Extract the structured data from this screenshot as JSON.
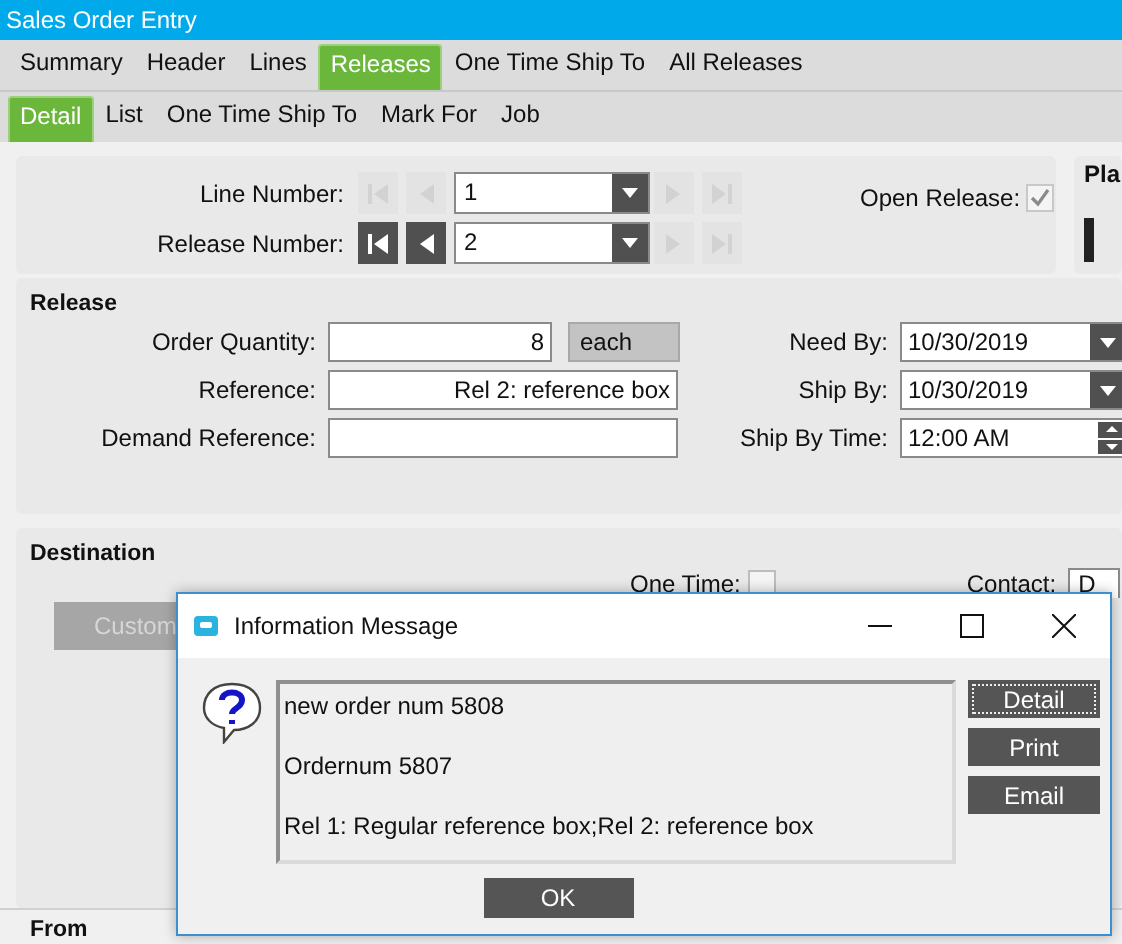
{
  "window": {
    "title": "Sales Order Entry"
  },
  "tabs": [
    {
      "label": "Summary",
      "selected": false
    },
    {
      "label": "Header",
      "selected": false
    },
    {
      "label": "Lines",
      "selected": false
    },
    {
      "label": "Releases",
      "selected": true
    },
    {
      "label": "One Time Ship To",
      "selected": false
    },
    {
      "label": "All Releases",
      "selected": false
    }
  ],
  "subtabs": [
    {
      "label": "Detail",
      "selected": true
    },
    {
      "label": "List",
      "selected": false
    },
    {
      "label": "One Time Ship To",
      "selected": false
    },
    {
      "label": "Mark For",
      "selected": false
    },
    {
      "label": "Job",
      "selected": false
    }
  ],
  "selectors": [
    {
      "label": "Line Number:",
      "value": "1",
      "nav": [
        {
          "kind": "first",
          "disabled": true
        },
        {
          "kind": "prev",
          "disabled": true
        },
        {
          "kind": "next",
          "disabled": true
        },
        {
          "kind": "last",
          "disabled": true
        }
      ]
    },
    {
      "label": "Release Number:",
      "value": "2",
      "nav": [
        {
          "kind": "first",
          "disabled": false
        },
        {
          "kind": "prev",
          "disabled": false
        },
        {
          "kind": "next",
          "disabled": true
        },
        {
          "kind": "last",
          "disabled": true
        }
      ]
    }
  ],
  "open_release": {
    "label": "Open Release:",
    "checked": true,
    "disabled": true
  },
  "plan_panel": {
    "title": "Pla"
  },
  "release": {
    "title": "Release",
    "order_quantity": {
      "label": "Order Quantity:",
      "value": "8",
      "uom": "each"
    },
    "reference": {
      "label": "Reference:",
      "value": "Rel 2: reference box"
    },
    "demand_reference": {
      "label": "Demand Reference:"
    },
    "need_by": {
      "label": "Need By:",
      "value": "10/30/2019"
    },
    "ship_by": {
      "label": "Ship By:",
      "value": "10/30/2019"
    },
    "ship_by_time": {
      "label": "Ship By Time:",
      "value": "12:00 AM"
    }
  },
  "destination": {
    "title": "Destination",
    "one_time": {
      "label": "One Time:",
      "checked": false
    },
    "contact": {
      "label": "Contact:",
      "value": "D"
    },
    "custom_button": "Custom"
  },
  "from": {
    "title": "From"
  },
  "dialog": {
    "title": "Information Message",
    "message_lines": [
      "new order num 5808",
      "Ordernum 5807",
      "Rel 1: Regular reference box;Rel 2: reference box"
    ],
    "side_buttons": [
      {
        "label": "Detail",
        "focused": true
      },
      {
        "label": "Print",
        "focused": false
      },
      {
        "label": "Email",
        "focused": false
      }
    ],
    "ok_button": "OK"
  }
}
